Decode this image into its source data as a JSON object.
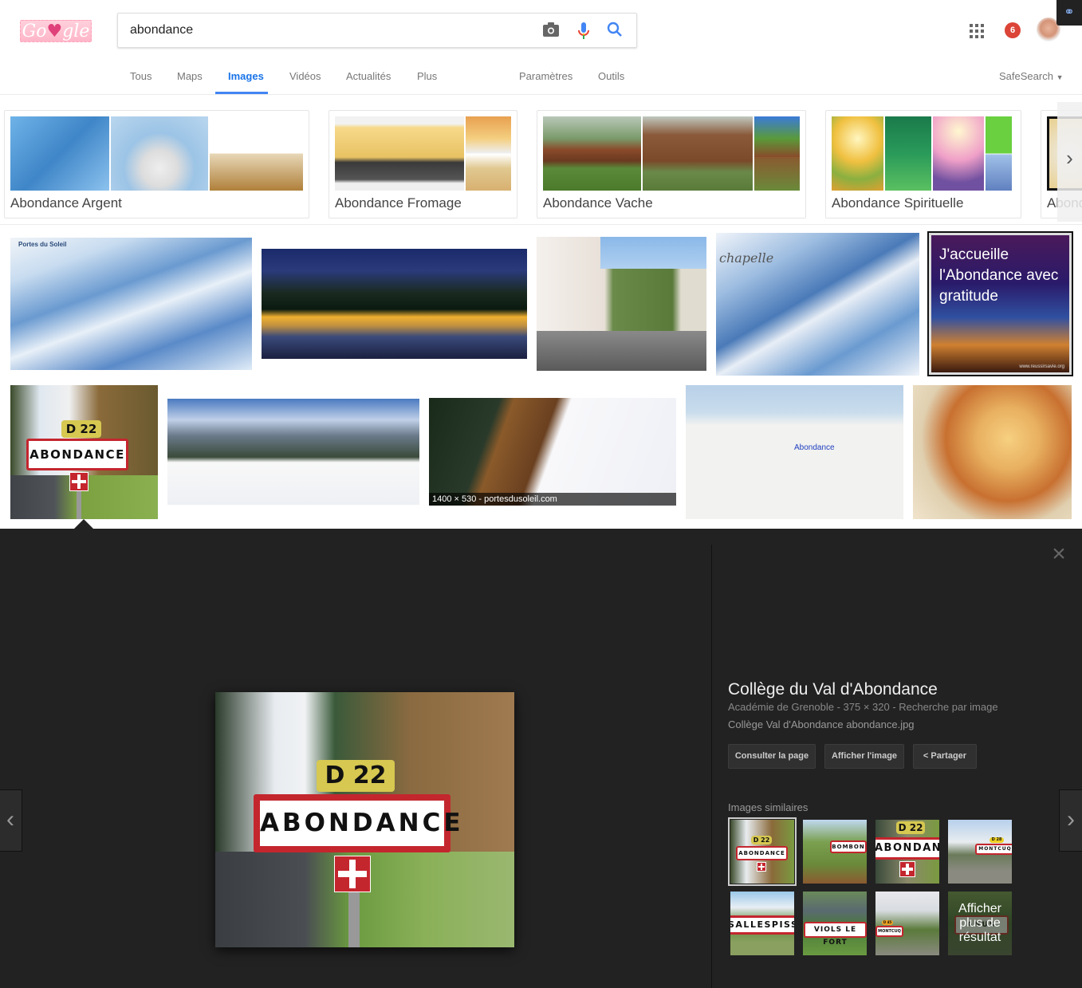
{
  "header": {
    "logo_text_left": "Go",
    "logo_text_right": "gle",
    "search_value": "abondance",
    "notifications_count": "6",
    "icons": [
      "camera-icon",
      "microphone-icon",
      "search-icon",
      "apps-grid-icon",
      "notification-badge",
      "account-avatar",
      "extension-link-icon"
    ]
  },
  "tabs": [
    {
      "label": "Tous",
      "active": false
    },
    {
      "label": "Maps",
      "active": false
    },
    {
      "label": "Images",
      "active": true
    },
    {
      "label": "Vidéos",
      "active": false
    },
    {
      "label": "Actualités",
      "active": false
    },
    {
      "label": "Plus",
      "active": false
    },
    {
      "label": "Paramètres",
      "active": false
    },
    {
      "label": "Outils",
      "active": false
    }
  ],
  "safesearch": "SafeSearch",
  "related": [
    {
      "label": "Abondance Argent"
    },
    {
      "label": "Abondance Fromage"
    },
    {
      "label": "Abondance Vache"
    },
    {
      "label": "Abondance Spirituelle"
    },
    {
      "label": "Abond"
    }
  ],
  "results": {
    "row1": [
      {
        "alt": "Portes du Soleil ski map",
        "text": "Portes du Soleil"
      },
      {
        "alt": "Abondance village at night"
      },
      {
        "alt": "Abondance street with hotel"
      },
      {
        "alt": "La Chapelle ski map",
        "text": "chapelle"
      },
      {
        "alt": "J'accueille l'Abondance avec gratitude",
        "text": "J'accueille l'Abondance avec gratitude",
        "footer": "www.reussirsavie.org"
      }
    ],
    "row2": [
      {
        "alt": "Abondance road sign",
        "sign": "ABONDANCE",
        "road": "D 22",
        "selected": true
      },
      {
        "alt": "Skiers on slope"
      },
      {
        "alt": "Snow chalet",
        "caption": "1400 × 530 - portesdusoleil.com"
      },
      {
        "alt": "Map of Abondance",
        "text": "Abondance"
      },
      {
        "alt": "Abondance cheese wheel"
      }
    ]
  },
  "panel": {
    "title": "Collège du Val d'Abondance",
    "meta": "Académie de Grenoble - 375 × 320 - Recherche par image",
    "filename": "Collège Val d'Abondance abondance.jpg",
    "buttons": {
      "visit": "Consulter la page",
      "view": "Afficher l'image",
      "share": "Partager"
    },
    "main_image": {
      "road": "D 22",
      "sign": "ABONDANCE"
    },
    "similar_label": "Images similaires",
    "similar": [
      {
        "sign": "ABONDANCE",
        "road": "D 22",
        "selected": true
      },
      {
        "sign": "BOMBON"
      },
      {
        "sign": "ABONDANCE",
        "road": "D 22"
      },
      {
        "sign": "MONTCUQ",
        "road": "D 28"
      },
      {
        "sign": "SALLESPISS"
      },
      {
        "sign": "VIOLS LE FORT"
      },
      {
        "sign": "MONTCUQ",
        "road": "D 45"
      },
      {
        "sign": "ANUS",
        "more": "Afficher plus de résultat"
      }
    ]
  }
}
